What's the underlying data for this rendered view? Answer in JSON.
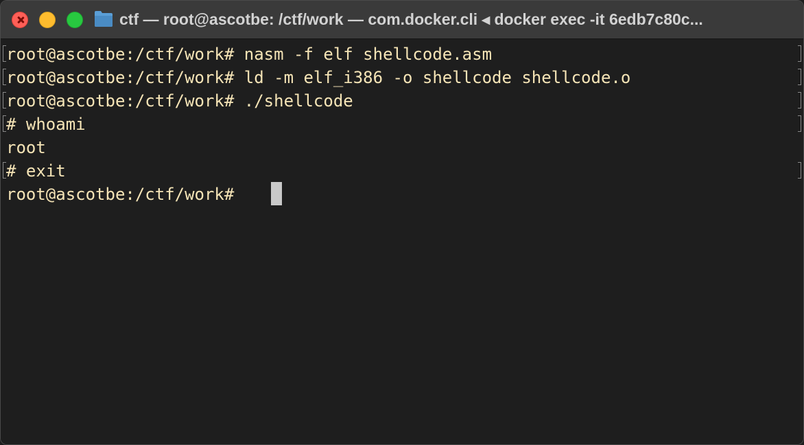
{
  "window": {
    "title": "ctf — root@ascotbe: /ctf/work — com.docker.cli ◂ docker exec -it 6edb7c80c..."
  },
  "terminal": {
    "lines": [
      "root@ascotbe:/ctf/work# nasm -f elf shellcode.asm",
      "root@ascotbe:/ctf/work# ld -m elf_i386 -o shellcode shellcode.o",
      "root@ascotbe:/ctf/work# ./shellcode",
      "# whoami",
      "root",
      "# exit",
      "root@ascotbe:/ctf/work# "
    ]
  },
  "colors": {
    "text": "#f5e4b6",
    "background": "#1e1e1e",
    "titlebar": "#3a3a3a",
    "close": "#ff5f57",
    "minimize": "#febc2e",
    "zoom": "#28c840"
  },
  "icons": [
    "close-icon",
    "minimize-icon",
    "zoom-icon",
    "folder-icon"
  ]
}
